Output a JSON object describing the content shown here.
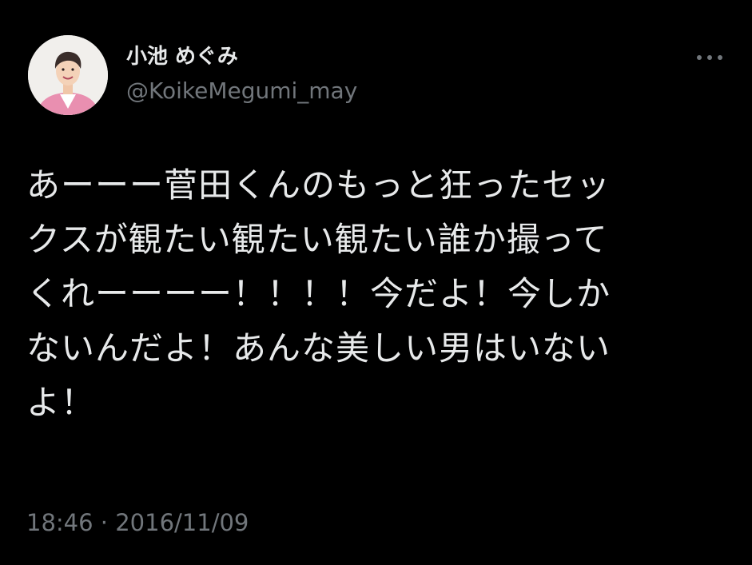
{
  "author": {
    "display_name": "小池 めぐみ",
    "handle": "@KoikeMegumi_may",
    "avatar_icon": "profile-photo"
  },
  "more_icon": "more-horizontal-icon",
  "tweet": {
    "lines": [
      "あーーー菅田くんのもっと狂ったセッ",
      "クスが観たい観たい観たい誰か撮って",
      "くれーーーー！！！！今だよ！今しか",
      "ないんだよ！あんな美しい男はいない",
      "よ！"
    ]
  },
  "meta": {
    "timestamp": "18:46 · 2016/11/09"
  },
  "colors": {
    "background": "#000000",
    "primary_text": "#e7e9ea",
    "secondary_text": "#71767b",
    "avatar_jacket": "#e98fb0"
  }
}
